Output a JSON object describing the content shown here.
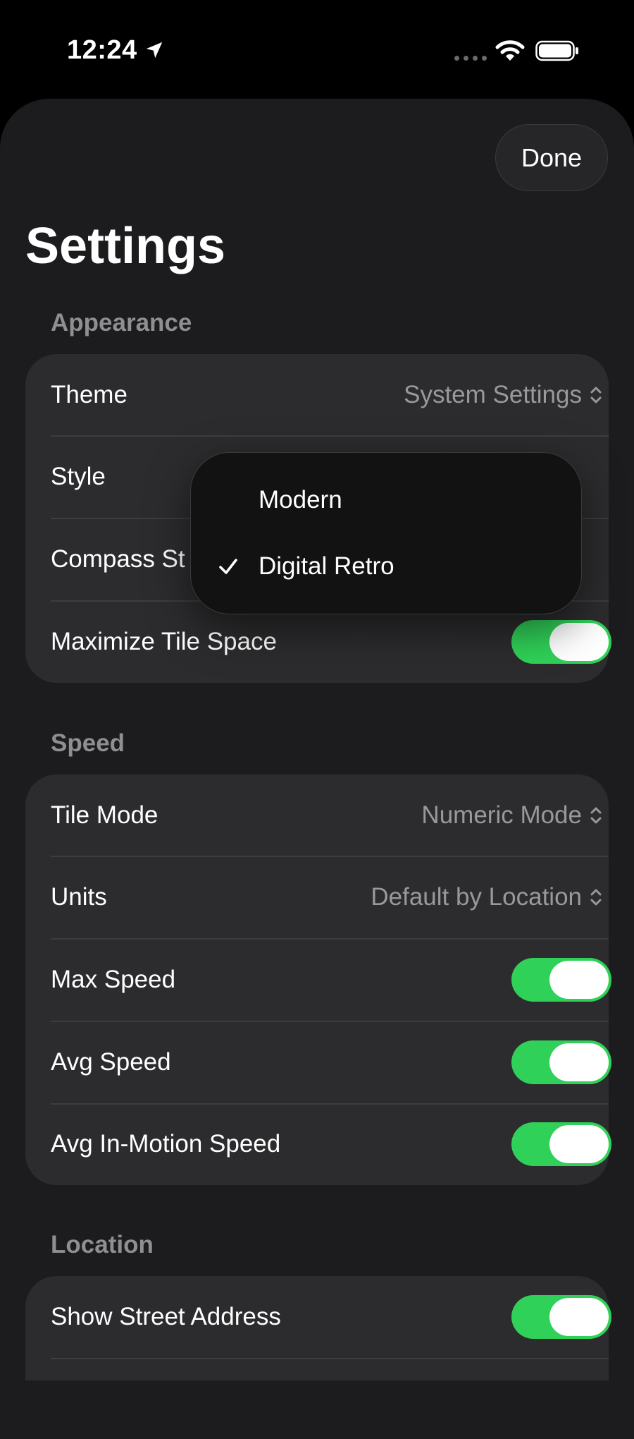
{
  "status_bar": {
    "time": "12:24",
    "icons": [
      "location-arrow-icon",
      "signal-dots-icon",
      "wifi-icon",
      "battery-icon"
    ]
  },
  "header": {
    "done_label": "Done",
    "title": "Settings"
  },
  "sections": {
    "appearance": {
      "header": "Appearance",
      "theme": {
        "label": "Theme",
        "value": "System Settings"
      },
      "style": {
        "label": "Style"
      },
      "compass_style": {
        "label": "Compass St"
      },
      "maximize_tile_space": {
        "label": "Maximize Tile Space",
        "on": true
      }
    },
    "speed": {
      "header": "Speed",
      "tile_mode": {
        "label": "Tile Mode",
        "value": "Numeric Mode"
      },
      "units": {
        "label": "Units",
        "value": "Default by Location"
      },
      "max_speed": {
        "label": "Max Speed",
        "on": true
      },
      "avg_speed": {
        "label": "Avg Speed",
        "on": true
      },
      "avg_in_motion_speed": {
        "label": "Avg In-Motion Speed",
        "on": true
      }
    },
    "location": {
      "header": "Location",
      "show_street_address": {
        "label": "Show Street Address",
        "on": true
      }
    }
  },
  "style_menu": {
    "options": [
      {
        "label": "Modern",
        "selected": false
      },
      {
        "label": "Digital Retro",
        "selected": true
      }
    ]
  },
  "colors": {
    "toggle_on": "#30d158",
    "background": "#1c1c1e",
    "card": "#2c2c2e",
    "secondary_text": "#98989d"
  }
}
